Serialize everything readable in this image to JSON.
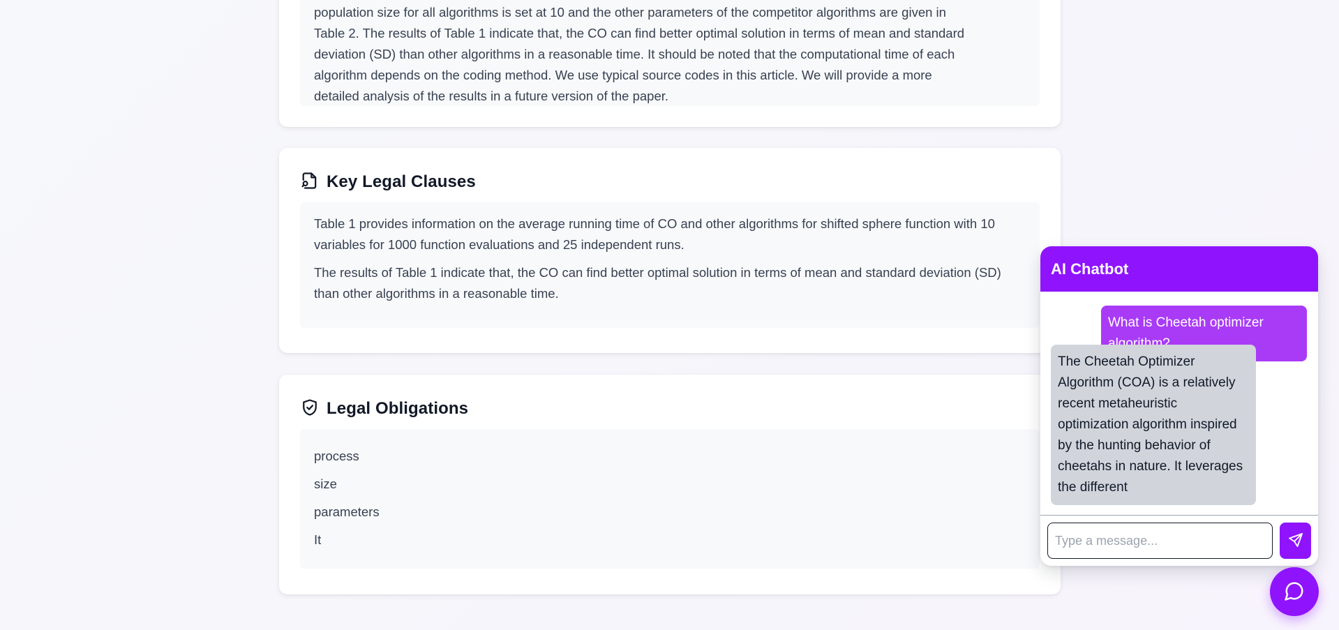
{
  "summary_card": {
    "text_lines": [
      "population size for all algorithms is set at 10 and the other parameters of the competitor algorithms are given in",
      "Table 2. The results of Table 1 indicate that, the CO can find better optimal solution in terms of mean and standard",
      "deviation (SD) than other algorithms in a reasonable time. It should be noted that the computational time of each",
      "algorithm depends on the coding method. We use typical source codes in this article. We will provide a more",
      "detailed analysis of the results in a future version of the paper."
    ]
  },
  "key_clauses": {
    "title": "Key Legal Clauses",
    "icon": "document-search-icon",
    "paragraphs": [
      "Table 1 provides information on the average running time of CO and other algorithms for shifted sphere function with 10 variables for 1000 function evaluations and 25 independent runs.",
      "The results of Table 1 indicate that, the CO can find better optimal solution in terms of mean and standard deviation (SD) than other algorithms in a reasonable time."
    ]
  },
  "obligations": {
    "title": "Legal Obligations",
    "icon": "shield-check-icon",
    "items": [
      "process",
      "size",
      "parameters",
      "It"
    ]
  },
  "chatbot": {
    "title": "AI Chatbot",
    "user_message": "What is Cheetah optimizer algorithm?",
    "bot_message": "The Cheetah Optimizer Algorithm (COA) is a relatively recent metaheuristic optimization algorithm inspired by the hunting behavior of cheetahs in nature. It leverages the different",
    "input_placeholder": "Type a message...",
    "input_value": "",
    "send_icon": "send-icon",
    "toggle_icon": "chat-bubble-icon"
  },
  "colors": {
    "accent": "#9013fe",
    "user_bubble": "#a93bf7",
    "bot_bubble": "#d1d5db"
  }
}
